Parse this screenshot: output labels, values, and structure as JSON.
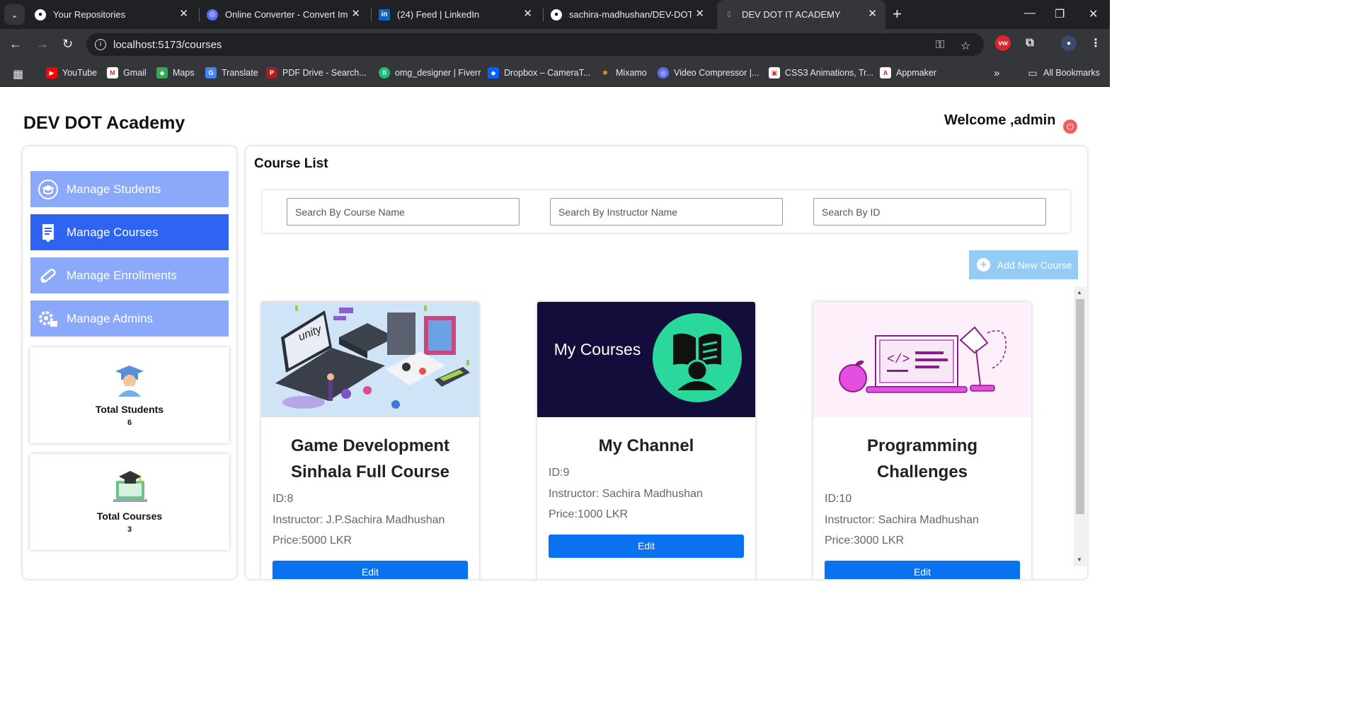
{
  "browser": {
    "tabs": [
      {
        "title": "Your Repositories",
        "icon": "github-icon"
      },
      {
        "title": "Online Converter - Convert Ima",
        "icon": "converter-icon"
      },
      {
        "title": "(24) Feed | LinkedIn",
        "icon": "linkedin-icon"
      },
      {
        "title": "sachira-madhushan/DEV-DOT-I",
        "icon": "github-icon"
      },
      {
        "title": "DEV DOT IT ACADEMY",
        "icon": "page-icon",
        "active": true
      }
    ],
    "url": "localhost:5173/courses",
    "bookmarks": [
      {
        "label": "YouTube",
        "icon": "youtube-icon"
      },
      {
        "label": "Gmail",
        "icon": "gmail-icon"
      },
      {
        "label": "Maps",
        "icon": "maps-icon"
      },
      {
        "label": "Translate",
        "icon": "translate-icon"
      },
      {
        "label": "PDF Drive - Search...",
        "icon": "pdfdrive-icon"
      },
      {
        "label": "omg_designer | Fiverr",
        "icon": "fiverr-icon"
      },
      {
        "label": "Dropbox – CameraT...",
        "icon": "dropbox-icon"
      },
      {
        "label": "Mixamo",
        "icon": "mixamo-icon"
      },
      {
        "label": "Video Compressor |...",
        "icon": "video-compressor-icon"
      },
      {
        "label": "CSS3 Animations, Tr...",
        "icon": "css3-icon"
      },
      {
        "label": "Appmaker",
        "icon": "appmaker-icon"
      }
    ],
    "all_bookmarks": "All Bookmarks"
  },
  "header": {
    "brand": "DEV DOT Academy",
    "welcome": "Welcome ,admin"
  },
  "sidebar": {
    "items": [
      {
        "label": "Manage Students",
        "icon": "students-icon",
        "active": false
      },
      {
        "label": "Manage Courses",
        "icon": "courses-icon",
        "active": true
      },
      {
        "label": "Manage Enrollments",
        "icon": "enrollments-icon",
        "active": false
      },
      {
        "label": "Manage Admins",
        "icon": "admins-icon",
        "active": false
      }
    ],
    "stats": [
      {
        "label": "Total Students",
        "value": "6",
        "icon": "graduate-icon"
      },
      {
        "label": "Total Courses",
        "value": "3",
        "icon": "laptop-graduation-icon"
      }
    ]
  },
  "main": {
    "title": "Course List",
    "search": {
      "course_placeholder": "Search By Course Name",
      "instructor_placeholder": "Search By Instructor Name",
      "id_placeholder": "Search By ID"
    },
    "add_button": "Add New Course",
    "courses": [
      {
        "title": "Game Development Sinhala Full Course",
        "id": "ID:8",
        "instructor": "Instructor: J.P.Sachira Madhushan",
        "price": "Price:5000 LKR",
        "edit": "Edit"
      },
      {
        "title": "My Channel",
        "id": "ID:9",
        "instructor": "Instructor: Sachira Madhushan",
        "price": "Price:1000 LKR",
        "edit": "Edit",
        "thumb_text": "My Courses"
      },
      {
        "title": "Programming Challenges",
        "id": "ID:10",
        "instructor": "Instructor: Sachira Madhushan",
        "price": "Price:3000 LKR",
        "edit": "Edit"
      }
    ]
  },
  "colors": {
    "menu": "#8ba9fb",
    "menu_active": "#2f64f2",
    "edit_button": "#0a72ee",
    "add_button": "#93ccf5"
  }
}
